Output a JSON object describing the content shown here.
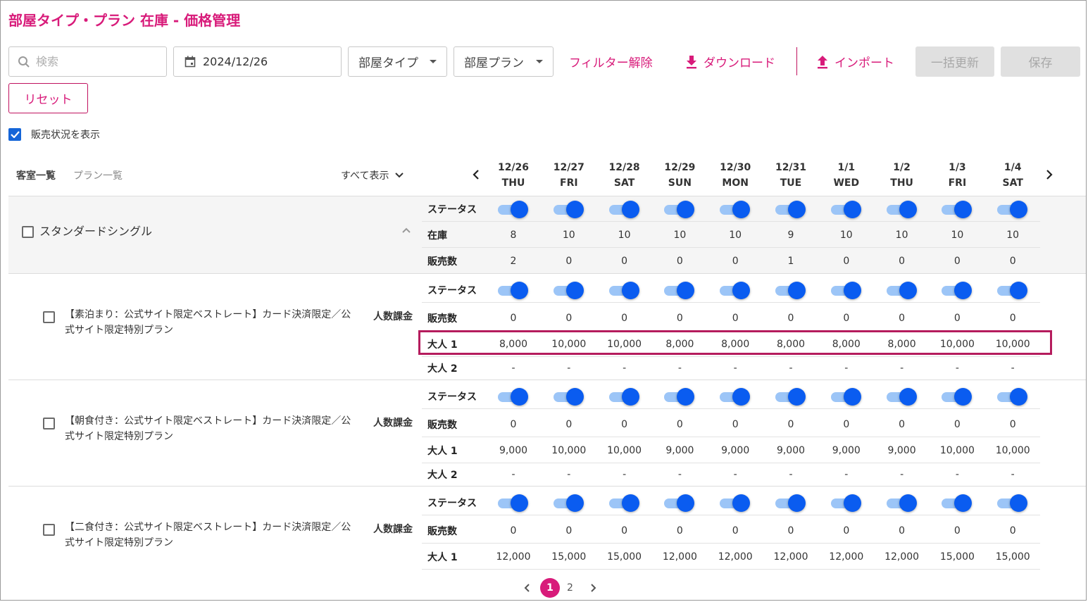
{
  "header": {
    "title": "部屋タイプ・プラン 在庫 - 価格管理"
  },
  "toolbar": {
    "search_placeholder": "検索",
    "date_value": "2024/12/26",
    "room_type_select": "部屋タイプ",
    "room_plan_select": "部屋プラン",
    "filter_clear": "フィルター解除",
    "download": "ダウンロード",
    "import": "インポート",
    "bulk_update": "一括更新",
    "save": "保存",
    "reset": "リセット"
  },
  "show_status": {
    "label": "販売状況を表示",
    "checked": true
  },
  "tabs": {
    "rooms": "客室一覧",
    "plans": "プラン一覧"
  },
  "show_all": "すべて表示",
  "dates": [
    {
      "date": "12/26",
      "day": "THU"
    },
    {
      "date": "12/27",
      "day": "FRI"
    },
    {
      "date": "12/28",
      "day": "SAT"
    },
    {
      "date": "12/29",
      "day": "SUN"
    },
    {
      "date": "12/30",
      "day": "MON"
    },
    {
      "date": "12/31",
      "day": "TUE"
    },
    {
      "date": "1/1",
      "day": "WED"
    },
    {
      "date": "1/2",
      "day": "THU"
    },
    {
      "date": "1/3",
      "day": "FRI"
    },
    {
      "date": "1/4",
      "day": "SAT"
    }
  ],
  "labels": {
    "status": "ステータス",
    "inventory": "在庫",
    "sold": "販売数",
    "adult1": "大人 1",
    "adult2": "大人 2",
    "per_person": "人数課金"
  },
  "room": {
    "name": "スタンダードシングル",
    "inventory": [
      "8",
      "10",
      "10",
      "10",
      "10",
      "9",
      "10",
      "10",
      "10",
      "10"
    ],
    "sold": [
      "2",
      "0",
      "0",
      "0",
      "0",
      "1",
      "0",
      "0",
      "0",
      "0"
    ]
  },
  "plans": [
    {
      "name": "【素泊まり：公式サイト限定ベストレート】カード決済限定／公式サイト限定特別プラン",
      "sold": [
        "0",
        "0",
        "0",
        "0",
        "0",
        "0",
        "0",
        "0",
        "0",
        "0"
      ],
      "adult1": [
        "8,000",
        "10,000",
        "10,000",
        "8,000",
        "8,000",
        "8,000",
        "8,000",
        "8,000",
        "10,000",
        "10,000"
      ],
      "adult2": [
        "-",
        "-",
        "-",
        "-",
        "-",
        "-",
        "-",
        "-",
        "-",
        "-"
      ]
    },
    {
      "name": "【朝食付き：公式サイト限定ベストレート】カード決済限定／公式サイト限定特別プラン",
      "sold": [
        "0",
        "0",
        "0",
        "0",
        "0",
        "0",
        "0",
        "0",
        "0",
        "0"
      ],
      "adult1": [
        "9,000",
        "10,000",
        "10,000",
        "9,000",
        "9,000",
        "9,000",
        "9,000",
        "9,000",
        "10,000",
        "10,000"
      ],
      "adult2": [
        "-",
        "-",
        "-",
        "-",
        "-",
        "-",
        "-",
        "-",
        "-",
        "-"
      ]
    },
    {
      "name": "【二食付き：公式サイト限定ベストレート】カード決済限定／公式サイト限定特別プラン",
      "sold": [
        "0",
        "0",
        "0",
        "0",
        "0",
        "0",
        "0",
        "0",
        "0",
        "0"
      ],
      "adult1": [
        "12,000",
        "15,000",
        "15,000",
        "12,000",
        "12,000",
        "12,000",
        "12,000",
        "12,000",
        "15,000",
        "15,000"
      ]
    }
  ],
  "pagination": {
    "current": "1",
    "other": "2"
  },
  "colors": {
    "accent": "#d81b7a",
    "toggle_on": "#0a5cf0",
    "highlight": "#b51c5d"
  }
}
